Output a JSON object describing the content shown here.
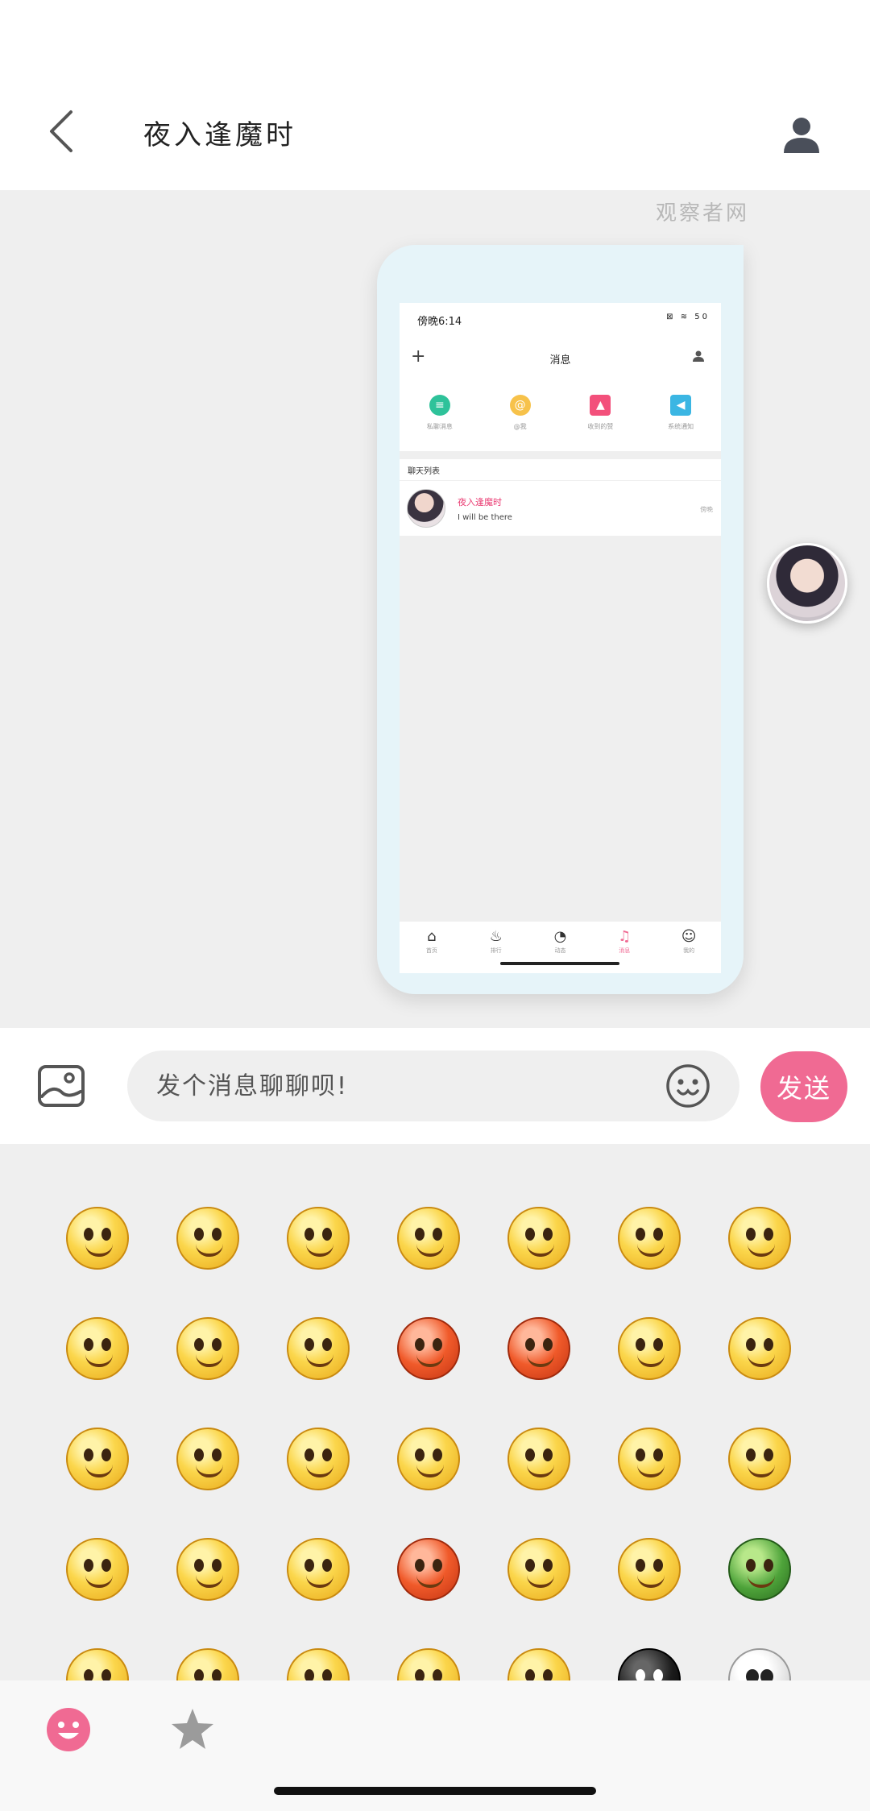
{
  "header": {
    "title": "夜入逢魔时",
    "back_icon": "chevron-left-icon",
    "profile_icon": "user-icon"
  },
  "chat": {
    "watermark": "观察者网",
    "image_message": {
      "phone_status_time": "傍晚6:14",
      "phone_status_icons": "⊠ ≋ 50",
      "phone_nav_title": "消息",
      "quick_actions": [
        {
          "label": "私聊消息",
          "color": "#2ec29a"
        },
        {
          "label": "@我",
          "color": "#f7c24a"
        },
        {
          "label": "收到的赞",
          "color": "#f3507b"
        },
        {
          "label": "系统通知",
          "color": "#3bb6e3"
        }
      ],
      "list_header": "聊天列表",
      "chat_item": {
        "name": "夜入逢魔时",
        "message": "I will be there",
        "time": "傍晚"
      },
      "tabs": [
        {
          "label": "首页",
          "icon": "⌂"
        },
        {
          "label": "排行",
          "icon": "♨"
        },
        {
          "label": "动态",
          "icon": "◔"
        },
        {
          "label": "消息",
          "icon": "♫"
        },
        {
          "label": "我的",
          "icon": "☺"
        }
      ]
    }
  },
  "input_bar": {
    "placeholder": "发个消息聊聊呗!",
    "send_label": "发送"
  },
  "emoji_panel": {
    "emojis": [
      "smile",
      "wobbly",
      "heart-eyes",
      "shocked",
      "cool",
      "crying",
      "glare",
      "shush",
      "sleepy",
      "tears-laugh",
      "angry-red",
      "furious",
      "tongue",
      "grin",
      "surprised",
      "frown",
      "blush",
      "laugh",
      "sick",
      "hand-mouth",
      "happy",
      "wow",
      "confused",
      "eye-roll",
      "panic",
      "sweat",
      "beam",
      "helmet",
      "bandana",
      "mischief",
      "question",
      "quiet",
      "dizzy",
      "black-cat",
      "skull"
    ],
    "tabs": {
      "emoji_icon": "smiley-icon",
      "favorites_icon": "star-icon"
    }
  },
  "colors": {
    "accent": "#f06a93",
    "chat_bg": "#efefef"
  }
}
